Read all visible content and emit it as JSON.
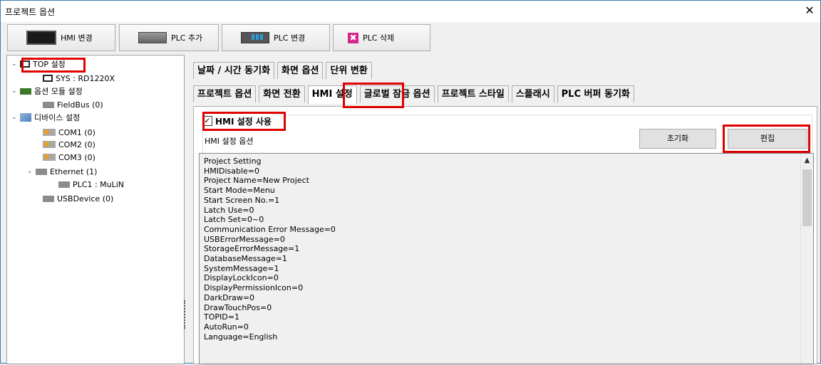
{
  "window": {
    "title": "프로젝트 옵션",
    "close_glyph": "✕"
  },
  "toolbar": {
    "buttons": [
      {
        "label": "HMI 변경",
        "icon": "monitor-icon"
      },
      {
        "label": "PLC 추가",
        "icon": "plc-add-icon"
      },
      {
        "label": "PLC 변경",
        "icon": "plc-change-icon"
      },
      {
        "label": "PLC 삭제",
        "icon": "delete-icon",
        "glyph": "✖"
      }
    ]
  },
  "tree": {
    "nodes": [
      {
        "label": "TOP 설정",
        "expander": "⌄"
      },
      {
        "label": "SYS : RD1220X"
      },
      {
        "label": "옵션 모듈 설정",
        "expander": "⌄"
      },
      {
        "label": "FieldBus (0)"
      },
      {
        "label": "디바이스 설정",
        "expander": "⌄"
      },
      {
        "label": "COM1 (0)"
      },
      {
        "label": "COM2 (0)"
      },
      {
        "label": "COM3 (0)"
      },
      {
        "label": "Ethernet (1)",
        "expander": "⌄"
      },
      {
        "label": "PLC1 : MuLiN"
      },
      {
        "label": "USBDevice (0)"
      }
    ]
  },
  "tabs": {
    "row1": [
      "날짜 / 시간 동기화",
      "화면 옵션",
      "단위 변환"
    ],
    "row2": [
      "프로젝트 옵션",
      "화면 전환",
      "HMI 설정",
      "글로벌 잠금 옵션",
      "프로젝트 스타일",
      "스플래시",
      "PLC 버퍼 동기화"
    ],
    "active": "HMI 설정"
  },
  "hmi": {
    "enable_label": "HMI 설정 사용",
    "enable_checked": true,
    "check_glyph": "✓",
    "options_label": "HMI 설정 옵션",
    "reset_label": "초기화",
    "edit_label": "편집",
    "settings_text": "Project Setting\nHMIDisable=0\nProject Name=New Project\nStart Mode=Menu\nStart Screen No.=1\nLatch Use=0\nLatch Set=0~0\nCommunication Error Message=0\nUSBErrorMessage=0\nStorageErrorMessage=1\nDatabaseMessage=1\nSystemMessage=1\nDisplayLockIcon=0\nDisplayPermissionIcon=0\nDarkDraw=0\nDrawTouchPos=0\nTOPID=1\nAutoRun=0\nLanguage=English",
    "scroll_up_glyph": "▲"
  },
  "colors": {
    "highlight": "#e00000",
    "window_border": "#3c7fb1"
  }
}
